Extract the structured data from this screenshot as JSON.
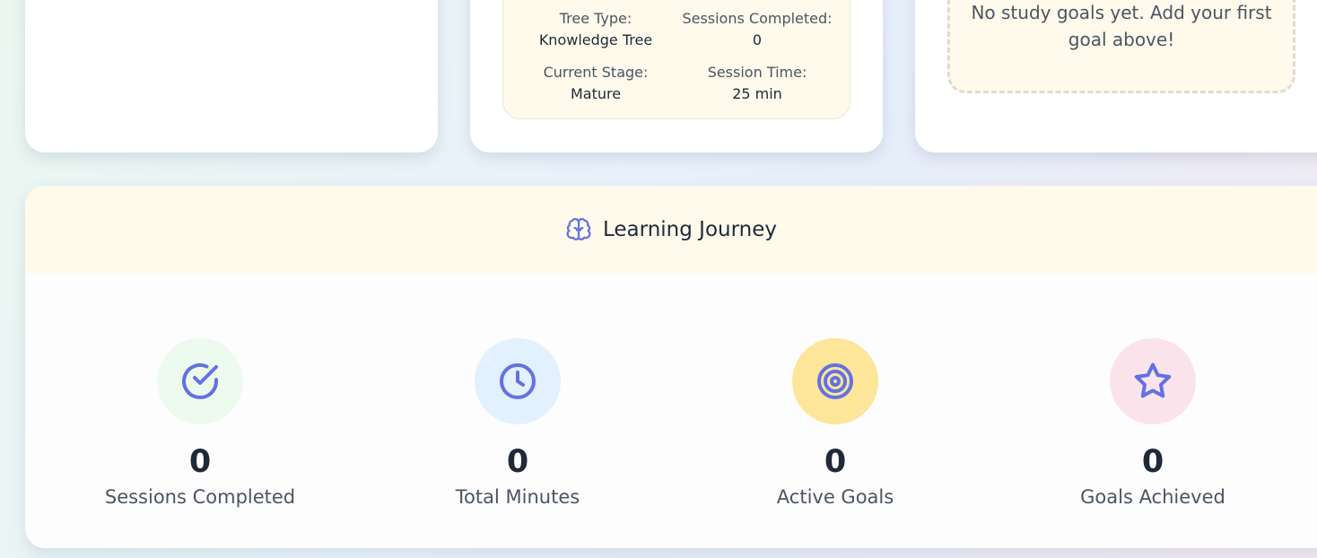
{
  "tree_card": {
    "tree_type_label": "Tree Type:",
    "tree_type_value": "Knowledge Tree",
    "sessions_label": "Sessions Completed:",
    "sessions_value": "0",
    "stage_label": "Current Stage:",
    "stage_value": "Mature",
    "session_time_label": "Session Time:",
    "session_time_value": "25 min"
  },
  "goals_card": {
    "empty_message": "No study goals yet. Add your first goal above!"
  },
  "journey": {
    "title": "Learning Journey",
    "title_icon": "brain-icon",
    "stats": [
      {
        "value": "0",
        "label": "Sessions Completed",
        "icon": "check-circle-icon",
        "bg": "#edfbef"
      },
      {
        "value": "0",
        "label": "Total Minutes",
        "icon": "clock-icon",
        "bg": "#e3f0fd"
      },
      {
        "value": "0",
        "label": "Active Goals",
        "icon": "target-icon",
        "bg": "#fde59a"
      },
      {
        "value": "0",
        "label": "Goals Achieved",
        "icon": "star-icon",
        "bg": "#fbe3ec"
      }
    ]
  },
  "colors": {
    "accent": "#6272e3",
    "panel_cream": "#fffaec"
  }
}
